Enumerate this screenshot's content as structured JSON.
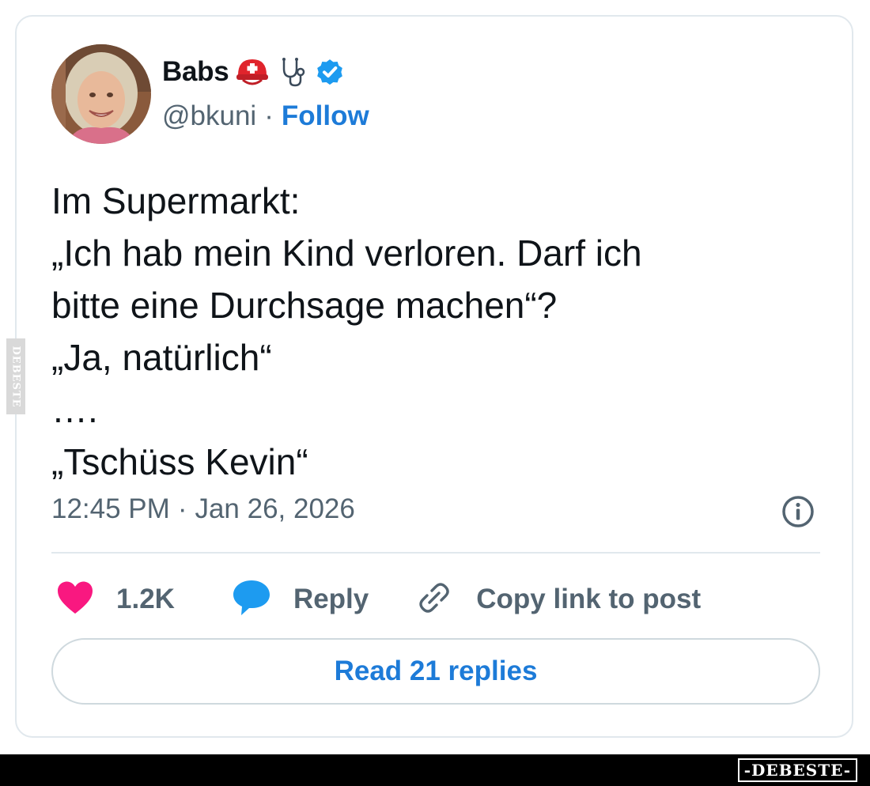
{
  "author": {
    "name": "Babs",
    "handle": "@bkuni",
    "separator": "·",
    "follow_label": "Follow",
    "icons": [
      "swiss-helmet-icon",
      "stethoscope-icon",
      "verified-badge-icon"
    ]
  },
  "tweet": {
    "lines": [
      "Im Supermarkt:",
      "„Ich hab mein Kind verloren. Darf ich",
      "bitte eine Durchsage machen“?",
      "„Ja, natürlich“",
      "….",
      "„Tschüss Kevin“"
    ],
    "time": "12:45 PM",
    "separator": "·",
    "date": "Jan 26, 2026"
  },
  "actions": {
    "likes": "1.2K",
    "reply_label": "Reply",
    "copy_label": "Copy link to post"
  },
  "read_replies_label": "Read 21 replies",
  "watermark": {
    "side": "DEBESTE",
    "logo": "-DEBESTE-"
  },
  "colors": {
    "accent": "#1d7bd8",
    "like": "#f91880",
    "reply_bubble": "#1d9bf0",
    "secondary_text": "#536471",
    "border": "#e1e8ed"
  }
}
